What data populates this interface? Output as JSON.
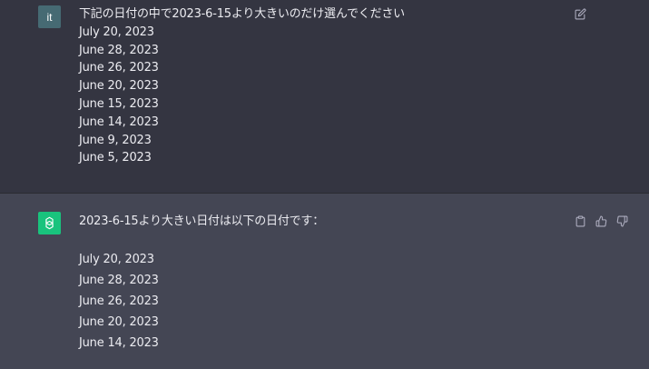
{
  "user_message": {
    "avatar_label": "it",
    "question": "下記の日付の中で2023-6-15より大きいのだけ選んでください",
    "dates": [
      "July 20, 2023",
      "June 28, 2023",
      "June 26, 2023",
      "June 20, 2023",
      "June 15, 2023",
      "June 14, 2023",
      "June 9, 2023",
      "June 5, 2023"
    ],
    "edit_icon": "edit-icon"
  },
  "assistant_message": {
    "avatar_icon": "openai-logo-icon",
    "intro": "2023-6-15より大きい日付は以下の日付です：",
    "dates": [
      "July 20, 2023",
      "June 28, 2023",
      "June 26, 2023",
      "June 20, 2023",
      "June 14, 2023"
    ],
    "actions": [
      "clipboard-icon",
      "thumbs-up-icon",
      "thumbs-down-icon"
    ]
  },
  "colors": {
    "user_bg": "#343541",
    "assistant_bg": "#444654",
    "user_avatar": "#466a73",
    "bot_avatar": "#19c37d",
    "text": "#ececf1",
    "icon": "#acacbe"
  }
}
